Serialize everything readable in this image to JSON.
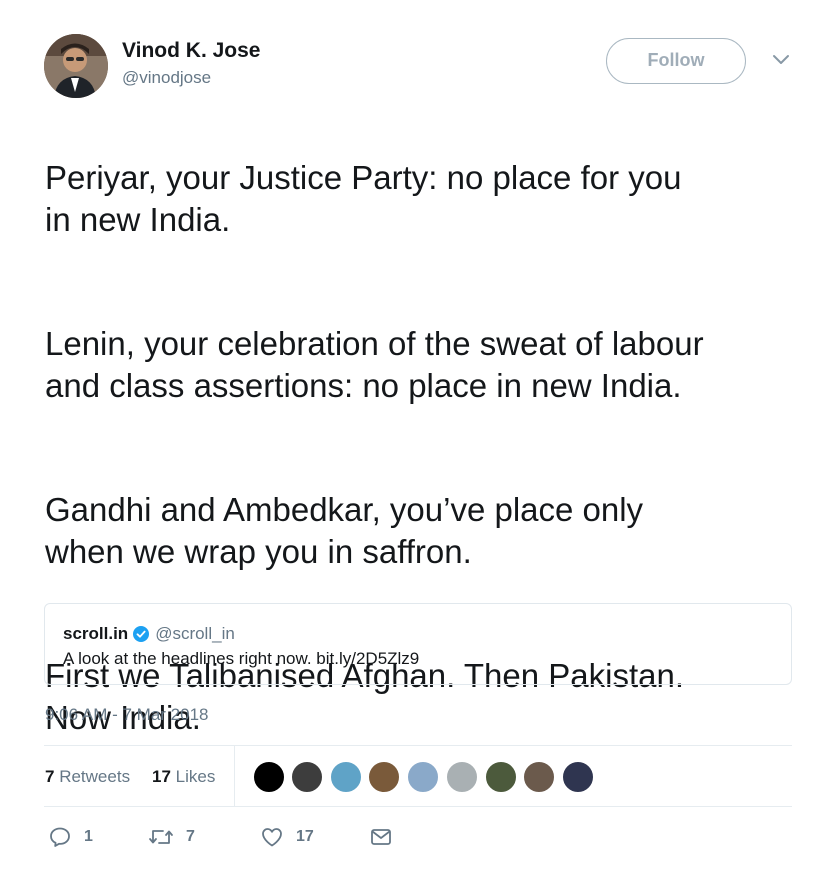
{
  "author": {
    "display_name": "Vinod K. Jose",
    "handle": "@vinodjose",
    "avatar_icon": "user-avatar"
  },
  "follow_label": "Follow",
  "tweet": {
    "paragraphs": [
      "Periyar, your Justice Party: no place for you\nin new India.",
      "Lenin, your celebration of the sweat of labour\nand class assertions: no place in new India.",
      "Gandhi and Ambedkar, you’ve place only\nwhen we wrap you in saffron.",
      "First we Talibanised Afghan. Then Pakistan.\nNow India."
    ]
  },
  "quote": {
    "name": "scroll.in",
    "handle": "@scroll_in",
    "text": "A look at the headlines right now. bit.ly/2D5Zlz9",
    "verified_icon": "verified-badge-icon"
  },
  "timestamp": "9:06 AM - 7 Mar 2018",
  "stats": {
    "retweets_count": "7",
    "retweets_label": "Retweets",
    "likes_count": "17",
    "likes_label": "Likes"
  },
  "actions": {
    "reply_count": "1",
    "retweet_count": "7",
    "like_count": "17"
  },
  "colors": {
    "text": "#14171a",
    "secondary": "#657786",
    "border": "#e1e8ed",
    "verified": "#1da1f2"
  }
}
